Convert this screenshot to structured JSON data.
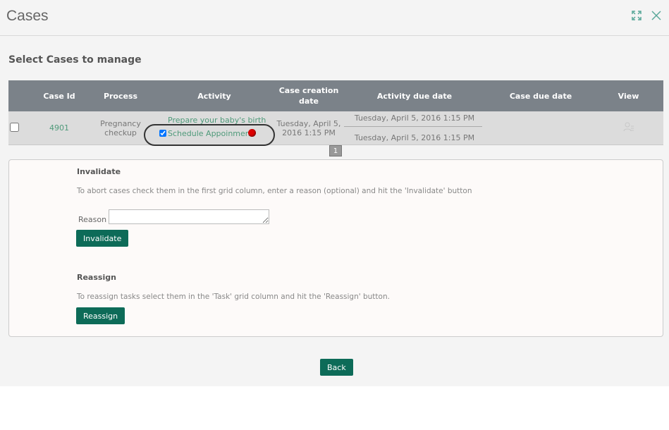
{
  "header": {
    "title": "Cases",
    "icons": [
      "expand-icon",
      "close-icon"
    ]
  },
  "subtitle": "Select Cases to manage",
  "table": {
    "columns": [
      "Case Id",
      "Process",
      "Activity",
      "Case creation date",
      "Activity due date",
      "Case due date",
      "View"
    ],
    "rows": [
      {
        "case_id": "4901",
        "process": "Pregnancy checkup",
        "activities": [
          {
            "label": "Prepare your baby's birth",
            "checked": false
          },
          {
            "label": "Schedule Appoinment",
            "checked": true,
            "status_color": "#dd0000"
          }
        ],
        "creation_date": "Tuesday, April 5, 2016 1:15 PM",
        "activity_due": [
          "Tuesday, April 5, 2016 1:15 PM",
          "Tuesday, April 5, 2016 1:15 PM"
        ],
        "case_due": "",
        "view_icon": "assign-user-icon"
      }
    ]
  },
  "pager": {
    "current": "1"
  },
  "invalidate": {
    "heading": "Invalidate",
    "text": "To abort cases check them in the first grid column, enter a reason (optional) and hit the 'Invalidate' button",
    "reason_label": "Reason",
    "reason_value": "",
    "button": "Invalidate"
  },
  "reassign": {
    "heading": "Reassign",
    "text": "To reassign tasks select them in the 'Task' grid column and hit the 'Reassign' button.",
    "button": "Reassign"
  },
  "back_button": "Back",
  "colors": {
    "accent": "#0d6b58",
    "link": "#4f9a7a",
    "table_header": "#7b8289"
  }
}
